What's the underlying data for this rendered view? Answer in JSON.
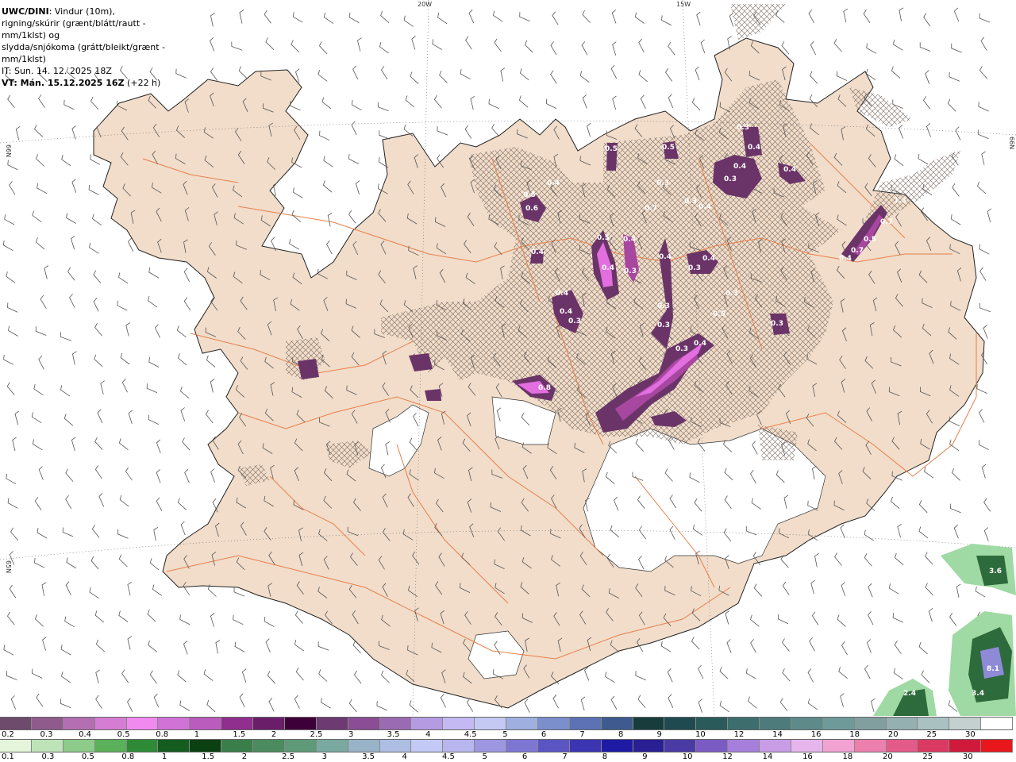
{
  "header": {
    "title": "UWC/DINI",
    "line1_rest": ": Vindur (10m),",
    "line2": "rigning/skúrir (grænt/blátt/rautt - mm/1klst) og",
    "line3": "slydda/snjókoma (grátt/bleikt/grænt - mm/1klst)",
    "line4": "IT: Sun. 14. 12. 2025 18Z",
    "line5_bold": "VT: Mán. 15.12.2025 16Z",
    "line5_rest": " (+22 h)"
  },
  "grid_labels": {
    "top_20w": "20W",
    "top_15w": "15W",
    "left_66n": "66N",
    "right_66n": "66N",
    "left_65n": "65N"
  },
  "colors": {
    "land": "#f1ddca",
    "glacier": "#ffffff",
    "roads": "#e8804a",
    "snow_dark": "#6b3468",
    "snow_mid": "#a8479f",
    "snow_light": "#e26ee0",
    "rain_green_dark": "#2e6b3c",
    "rain_green_light": "#9fd9a3"
  },
  "snow_labels": [
    "0.3",
    "0.4",
    "0.5",
    "0.4",
    "0.3",
    "0.4",
    "0.3",
    "0.5",
    "0.3",
    "0.4",
    "0.4",
    "0.5",
    "0.6",
    "0.7",
    "0.5",
    "0.4",
    "0.4",
    "0.4",
    "0.4",
    "0.3",
    "0.4",
    "0.3",
    "0.4",
    "0.3",
    "0.4",
    "0.3",
    "1.3",
    "0.7",
    "0.5",
    "0.7",
    "0.4",
    "0.3",
    "0.8",
    "0.3",
    "0.5",
    "0.3",
    "0.3",
    "0.4"
  ],
  "rain_labels": [
    "3.6",
    "8.1",
    "3.4",
    "2.4"
  ],
  "legend_snow": {
    "colors": [
      "#6e4a6c",
      "#8e5b8c",
      "#b36fb1",
      "#d47dd2",
      "#f08af0",
      "#d072d6",
      "#b95cbd",
      "#902f8e",
      "#6a1e6a",
      "#3e0038",
      "#6d3a72",
      "#8a4d96",
      "#9a6bb3",
      "#b49be2",
      "#c5b9f3",
      "#c4c9f4",
      "#9fb0e0",
      "#7b8fcc",
      "#5c72b4",
      "#3e5a8f",
      "#183c3c",
      "#1f4a4f",
      "#2a5a5a",
      "#3c6e6e",
      "#4d7b7b",
      "#5e8a8a",
      "#6f9a9a",
      "#819f9f",
      "#95b0b0",
      "#a9c1c1",
      "#c4cfcf",
      "#ffffff"
    ],
    "ticks": [
      "0.2",
      "0.3",
      "0.4",
      "0.5",
      "0.8",
      "1",
      "1.5",
      "2",
      "2.5",
      "3",
      "3.5",
      "4",
      "4.5",
      "5",
      "6",
      "7",
      "8",
      "9",
      "10",
      "12",
      "14",
      "16",
      "18",
      "20",
      "25",
      "30"
    ]
  },
  "legend_rain": {
    "colors": [
      "#e4f5dc",
      "#bfe3b9",
      "#8dcb8a",
      "#5bb05a",
      "#2e8a36",
      "#145c20",
      "#0a4012",
      "#3a7f4a",
      "#4b8b5f",
      "#5f9a78",
      "#7aa9a0",
      "#98b3c8",
      "#aebde2",
      "#c2c9f4",
      "#b8b6ee",
      "#9d97e1",
      "#7d77d3",
      "#5b55c3",
      "#3c35b2",
      "#1e1aa3",
      "#2a1e93",
      "#4a3aa3",
      "#7a5bc3",
      "#a67fdc",
      "#c99de6",
      "#e6b5ec",
      "#f2a3d2",
      "#ec7fae",
      "#e45a88",
      "#da3a62",
      "#d01a3c",
      "#e8171b"
    ],
    "ticks": [
      "0.1",
      "0.3",
      "0.5",
      "0.8",
      "1",
      "1.5",
      "2",
      "2.5",
      "3",
      "3.5",
      "4",
      "4.5",
      "5",
      "6",
      "7",
      "8",
      "9",
      "10",
      "12",
      "14",
      "16",
      "18",
      "20",
      "25",
      "30"
    ]
  }
}
